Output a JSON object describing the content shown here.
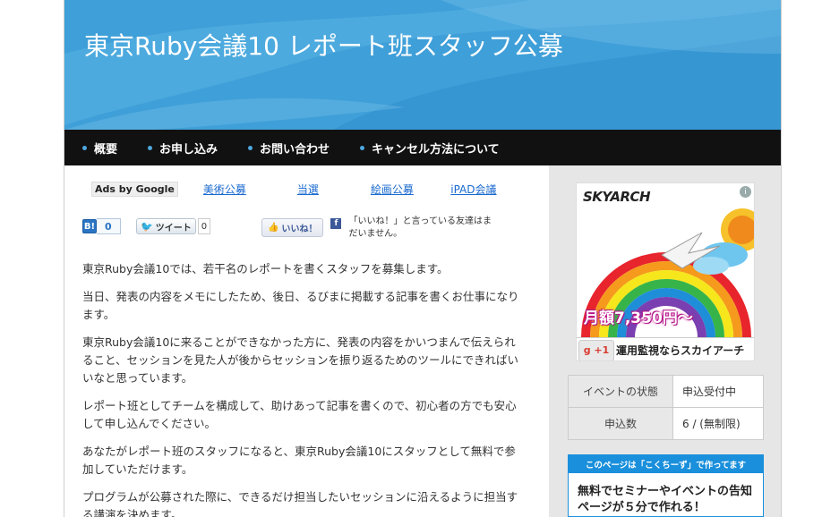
{
  "header": {
    "title": "東京Ruby会議10 レポート班スタッフ公募"
  },
  "nav": {
    "items": [
      {
        "label": "概要"
      },
      {
        "label": "お申し込み"
      },
      {
        "label": "お問い合わせ"
      },
      {
        "label": "キャンセル方法について"
      }
    ]
  },
  "ads": {
    "ads_by": "Ads by Google",
    "links": [
      {
        "label": "美術公募"
      },
      {
        "label": "当選"
      },
      {
        "label": "絵画公募"
      },
      {
        "label": "iPAD会議"
      }
    ]
  },
  "social": {
    "hatena_icon": "B!",
    "hatena_count": "0",
    "tweet_label": "ツイート",
    "tweet_count": "0",
    "like_label": "いいね！",
    "facebook_icon": "f",
    "like_message": "「いいね！」と言っている友達はまだいません。"
  },
  "body": {
    "paragraphs": [
      "東京Ruby会議10では、若干名のレポートを書くスタッフを募集します。",
      "当日、発表の内容をメモにしたため、後日、るびまに掲載する記事を書くお仕事になります。",
      "東京Ruby会議10に来ることができなかった方に、発表の内容をかいつまんで伝えられること、セッションを見た人が後からセッションを振り返るためのツールにできればいいなと思っています。",
      "レポート班としてチームを構成して、助けあって記事を書くので、初心者の方でも安心して申し込んでください。",
      "あなたがレポート班のスタッフになると、東京Ruby会議10にスタッフとして無料で参加していただけます。",
      "プログラムが公募された際に、できるだけ担当したいセッションに沿えるように担当する講演を決めます。"
    ]
  },
  "sidebar": {
    "ad": {
      "logo": "SKYARCH",
      "info_icon": "i",
      "price": "月額7,350円～",
      "gplus": "g +1",
      "slogan": "運用監視ならスカイアーチ"
    },
    "status_table": [
      {
        "key": "イベントの状態",
        "value": "申込受付中"
      },
      {
        "key": "申込数",
        "value": "6 / (無制限)"
      }
    ],
    "promo": {
      "header": "このページは「こくちーず」で作ってます",
      "text": "無料でセミナーやイベントの告知ページが５分で作れる！"
    }
  },
  "colors": {
    "header_blue": "#3f9fd8",
    "nav_black": "#111111",
    "link_blue": "#1a6ad0",
    "promo_blue": "#1a8fdc"
  }
}
